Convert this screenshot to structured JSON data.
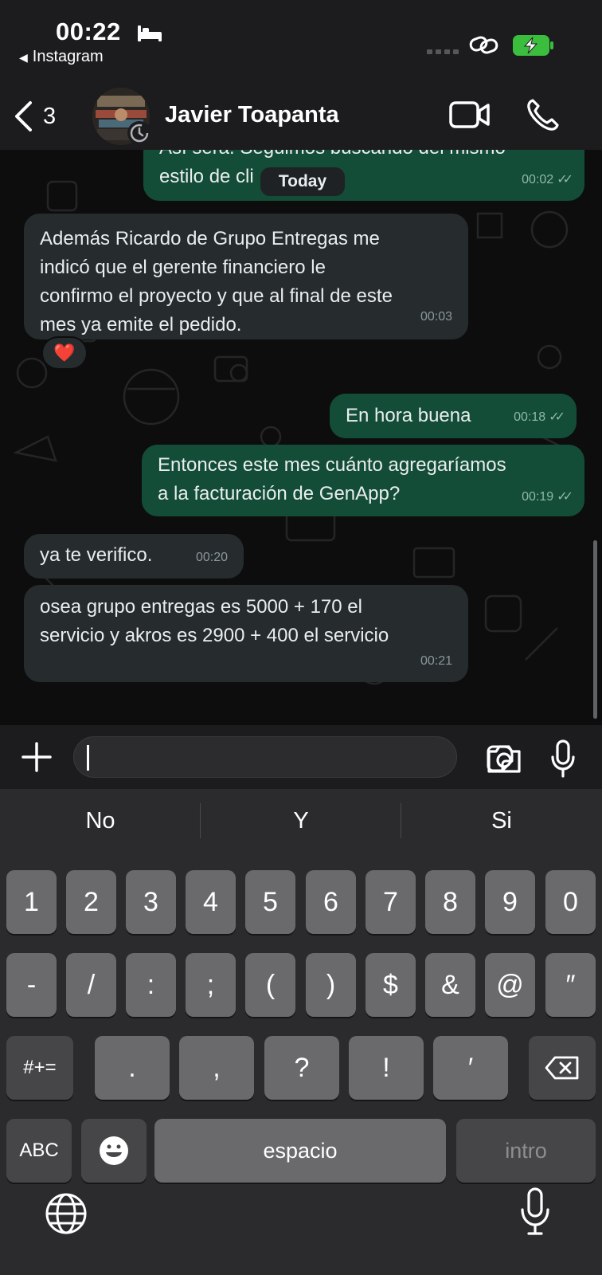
{
  "status_bar": {
    "time": "00:22",
    "back_app": "Instagram"
  },
  "header": {
    "back_count": "3",
    "contact_name": "Javier Toapanta"
  },
  "chat": {
    "partial_message": {
      "text_top": "Así será. Seguimos buscando del mismo",
      "text_visible": "estilo de cli",
      "time": "00:02"
    },
    "date_divider": "Today",
    "messages": [
      {
        "dir": "in",
        "lines": [
          "Además Ricardo de Grupo Entregas me",
          "indicó que el gerente financiero le",
          "confirmo el proyecto y que al final de este",
          "mes ya emite el pedido."
        ],
        "time": "00:03",
        "reaction": "❤️"
      },
      {
        "dir": "out",
        "lines": [
          "En hora buena"
        ],
        "time": "00:18"
      },
      {
        "dir": "out",
        "lines": [
          "Entonces este mes cuánto agregaríamos",
          "a la facturación de GenApp?"
        ],
        "time": "00:19"
      },
      {
        "dir": "in",
        "lines": [
          "ya te verifico."
        ],
        "time": "00:20"
      },
      {
        "dir": "in",
        "lines": [
          "osea grupo entregas es 5000 + 170 el",
          "servicio y akros es 2900 + 400 el servicio"
        ],
        "time": "00:21"
      }
    ]
  },
  "composer": {
    "value": "",
    "placeholder": ""
  },
  "keyboard": {
    "suggestions": [
      "No",
      "Y",
      "Si"
    ],
    "row1": [
      "1",
      "2",
      "3",
      "4",
      "5",
      "6",
      "7",
      "8",
      "9",
      "0"
    ],
    "row2": [
      "-",
      "/",
      ":",
      ";",
      "(",
      ")",
      "$",
      "&",
      "@",
      "″"
    ],
    "row3": [
      "#+=",
      ".",
      ",",
      "?",
      "!",
      "′"
    ],
    "abc": "ABC",
    "space": "espacio",
    "return": "intro"
  },
  "colors": {
    "outgoing_bubble": "#134d37",
    "incoming_bubble": "#262b2d",
    "accent_green": "#25d366"
  }
}
